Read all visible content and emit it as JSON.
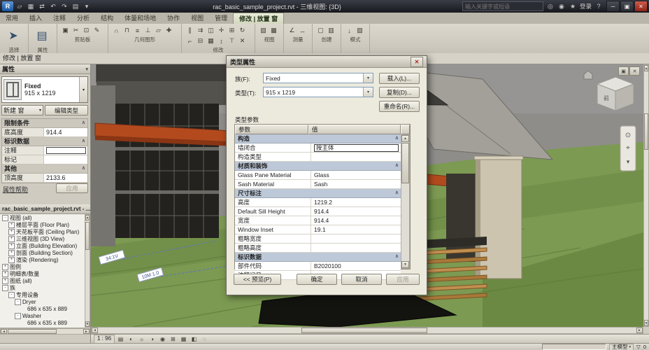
{
  "ui": {
    "dropdown_glyph": "▾",
    "pin_glyph": "∧",
    "up_glyph": "▲",
    "down_glyph": "▼",
    "left_glyph": "◄",
    "right_glyph": "►",
    "close_glyph": "✕",
    "restore_glyph": "▣"
  },
  "window": {
    "title": "rac_basic_sample_project.rvt - 三维视图: {3D}",
    "search_placeholder": "输入关键字或短语",
    "sign_in": "登录",
    "help_glyph": "?",
    "quick_access": [
      {
        "name": "app-menu-button",
        "glyph": "R",
        "big": true
      },
      {
        "name": "open-icon",
        "glyph": "▱"
      },
      {
        "name": "save-icon",
        "glyph": "▦"
      },
      {
        "name": "sync-icon",
        "glyph": "⇄"
      },
      {
        "name": "undo-icon",
        "glyph": "↶"
      },
      {
        "name": "redo-icon",
        "glyph": "↷"
      },
      {
        "name": "print-icon",
        "glyph": "▤"
      },
      {
        "name": "qat-customize-icon",
        "glyph": "▾"
      }
    ],
    "infocenter_icons": [
      {
        "name": "search-icon",
        "glyph": "◎"
      },
      {
        "name": "communication-center-icon",
        "glyph": "◉"
      },
      {
        "name": "favorites-icon",
        "glyph": "★"
      }
    ],
    "controls": [
      {
        "name": "minimize-button",
        "glyph": "─"
      },
      {
        "name": "restore-button",
        "glyph": "▣"
      },
      {
        "name": "close-button",
        "glyph": "✕",
        "close": true
      }
    ]
  },
  "ribbon": {
    "tabs": [
      "常用",
      "插入",
      "注释",
      "分析",
      "结构",
      "体量和场地",
      "协作",
      "视图",
      "管理",
      "修改 | 放置 窗"
    ],
    "active_tab": 9,
    "panels": [
      {
        "id": "select",
        "label": "选择",
        "icons": [
          {
            "name": "modify-tool-icon",
            "glyph": "➤",
            "big": true
          }
        ]
      },
      {
        "id": "properties",
        "label": "属性",
        "icons": [
          {
            "name": "properties-icon",
            "glyph": "▤",
            "big": true
          }
        ]
      },
      {
        "id": "clipboard",
        "label": "剪贴板",
        "icons": [
          {
            "name": "paste-icon",
            "glyph": "▣"
          },
          {
            "name": "cut-icon",
            "glyph": "✂"
          },
          {
            "name": "copy-icon",
            "glyph": "⊡"
          },
          {
            "name": "match-type-icon",
            "glyph": "✎"
          }
        ]
      },
      {
        "id": "geometry",
        "label": "几何图形",
        "icons": [
          {
            "name": "cope-icon",
            "glyph": "∩"
          },
          {
            "name": "cut-geometry-icon",
            "glyph": "⊓"
          },
          {
            "name": "join-geometry-icon",
            "glyph": "≡"
          },
          {
            "name": "wall-joins-icon",
            "glyph": "⊥"
          },
          {
            "name": "split-face-icon",
            "glyph": "▱"
          },
          {
            "name": "paint-icon",
            "glyph": "✚"
          }
        ]
      },
      {
        "id": "modify",
        "label": "修改",
        "icons": [
          {
            "name": "align-icon",
            "glyph": "∥"
          },
          {
            "name": "offset-icon",
            "glyph": "⇉"
          },
          {
            "name": "mirror-icon",
            "glyph": "◫"
          },
          {
            "name": "move-icon",
            "glyph": "✛"
          },
          {
            "name": "copy-element-icon",
            "glyph": "⊞"
          },
          {
            "name": "rotate-icon",
            "glyph": "↻"
          },
          {
            "name": "trim-icon",
            "glyph": "⌐"
          },
          {
            "name": "split-element-icon",
            "glyph": "⊟"
          },
          {
            "name": "array-icon",
            "glyph": "▦"
          },
          {
            "name": "scale-icon",
            "glyph": "↕"
          },
          {
            "name": "pin-icon",
            "glyph": "⊤"
          },
          {
            "name": "delete-icon",
            "glyph": "✕"
          }
        ]
      },
      {
        "id": "view",
        "label": "视图",
        "icons": [
          {
            "name": "thin-lines-icon",
            "glyph": "▨"
          },
          {
            "name": "close-hidden-icon",
            "glyph": "▩"
          }
        ]
      },
      {
        "id": "measure",
        "label": "测量",
        "icons": [
          {
            "name": "measure-icon",
            "glyph": "∠"
          },
          {
            "name": "dimension-icon",
            "glyph": "↔"
          }
        ]
      },
      {
        "id": "create",
        "label": "创建",
        "icons": [
          {
            "name": "create-similar-icon",
            "glyph": "▢"
          },
          {
            "name": "group-icon",
            "glyph": "▥"
          }
        ]
      },
      {
        "id": "mode",
        "label": "模式",
        "icons": [
          {
            "name": "load-family-icon",
            "glyph": "↓"
          },
          {
            "name": "model-in-place-icon",
            "glyph": "▧"
          }
        ]
      }
    ]
  },
  "properties": {
    "options_bar": "修改 | 放置 窗",
    "palette_title": "属性",
    "type_selector": {
      "family": "Fixed",
      "type": "915 x 1219"
    },
    "selection_combo": "新建 窗",
    "edit_type_button": "编辑类型",
    "rows": [
      {
        "kind": "group",
        "id": "constraints",
        "label": "限制条件"
      },
      {
        "kind": "row",
        "label": "底高度",
        "value": "914.4"
      },
      {
        "kind": "group",
        "id": "identity",
        "label": "标识数据"
      },
      {
        "kind": "row",
        "label": "注释",
        "value": "",
        "input": true
      },
      {
        "kind": "row",
        "label": "标记",
        "value": ""
      },
      {
        "kind": "group",
        "id": "other",
        "label": "其他"
      },
      {
        "kind": "row",
        "label": "顶高度",
        "value": "2133.6"
      }
    ],
    "help_link": "属性帮助",
    "apply_button": "应用"
  },
  "browser": {
    "title": "rac_basic_sample_project.rvt - ...",
    "items": [
      {
        "label": "视图 (all)",
        "indent": 0,
        "expander": "-"
      },
      {
        "label": "楼层平面 (Floor Plan)",
        "indent": 1,
        "expander": "+"
      },
      {
        "label": "天花板平面 (Ceiling Plan)",
        "indent": 1,
        "expander": "+"
      },
      {
        "label": "三维视图 (3D View)",
        "indent": 1,
        "expander": "+"
      },
      {
        "label": "立面 (Building Elevation)",
        "indent": 1,
        "expander": "+"
      },
      {
        "label": "剖面 (Building Section)",
        "indent": 1,
        "expander": "+"
      },
      {
        "label": "渲染 (Rendering)",
        "indent": 1,
        "expander": "+"
      },
      {
        "label": "图例",
        "indent": 0,
        "expander": "+"
      },
      {
        "label": "明细表/数量",
        "indent": 0,
        "expander": "+"
      },
      {
        "label": "图纸 (all)",
        "indent": 0,
        "expander": "+"
      },
      {
        "label": "族",
        "indent": 0,
        "expander": "-"
      },
      {
        "label": "专用设备",
        "indent": 1,
        "expander": "-"
      },
      {
        "label": "Dryer",
        "indent": 2,
        "expander": "-"
      },
      {
        "label": "686 x 635 x 889",
        "indent": 3,
        "expander": ""
      },
      {
        "label": "Washer",
        "indent": 2,
        "expander": "-"
      },
      {
        "label": "686 x 635 x 889",
        "indent": 3,
        "expander": ""
      }
    ]
  },
  "dialog": {
    "title": "类型属性",
    "family_label": "族(F):",
    "family_value": "Fixed",
    "load_button": "载入(L)...",
    "type_label": "类型(T):",
    "type_value": "915 x 1219",
    "duplicate_button": "复制(D)...",
    "rename_button": "重命名(R)...",
    "params_title": "类型参数",
    "col_param": "参数",
    "col_value": "值",
    "rows": [
      {
        "kind": "group",
        "label": "构造"
      },
      {
        "kind": "row",
        "label": "墙闭合",
        "value": "按主体",
        "editor": true
      },
      {
        "kind": "row",
        "label": "构造类型",
        "value": ""
      },
      {
        "kind": "group",
        "label": "材质和装饰"
      },
      {
        "kind": "row",
        "label": "Glass Pane Material",
        "value": "Glass"
      },
      {
        "kind": "row",
        "label": "Sash Material",
        "value": "Sash"
      },
      {
        "kind": "group",
        "label": "尺寸标注"
      },
      {
        "kind": "row",
        "label": "高度",
        "value": "1219.2"
      },
      {
        "kind": "row",
        "label": "Default Sill Height",
        "value": "914.4"
      },
      {
        "kind": "row",
        "label": "宽度",
        "value": "914.4"
      },
      {
        "kind": "row",
        "label": "Window Inset",
        "value": "19.1"
      },
      {
        "kind": "row",
        "label": "粗略宽度",
        "value": ""
      },
      {
        "kind": "row",
        "label": "粗略高度",
        "value": ""
      },
      {
        "kind": "group",
        "label": "标识数据"
      },
      {
        "kind": "row",
        "label": "部件代码",
        "value": "B2020100"
      },
      {
        "kind": "row",
        "label": "注释记号",
        "value": ""
      }
    ],
    "preview_button": "<< 预览(P)",
    "ok_button": "确定",
    "cancel_button": "取消",
    "apply_button": "应用"
  },
  "canvas": {
    "viewcube_front": "前",
    "labels": [
      "34:1V",
      "10M 1.0"
    ],
    "nav_icons": [
      "⊙",
      "⌖",
      "▾"
    ]
  },
  "status": {
    "view_scale": "1 : 96",
    "view_icons": [
      {
        "name": "detail-level-icon",
        "glyph": "▤"
      },
      {
        "name": "visual-style-icon",
        "glyph": "◐"
      },
      {
        "name": "sun-path-icon",
        "glyph": "☼"
      },
      {
        "name": "shadows-icon",
        "glyph": "◑"
      },
      {
        "name": "rendering-icon",
        "glyph": "◉"
      },
      {
        "name": "crop-view-icon",
        "glyph": "⊞"
      },
      {
        "name": "show-crop-icon",
        "glyph": "▦"
      },
      {
        "name": "temporary-hide-icon",
        "glyph": "◧"
      },
      {
        "name": "reveal-hidden-icon",
        "glyph": "◌"
      }
    ],
    "main_model_label": "主模型",
    "filter_glyph": "▽",
    "filter_count": "0"
  }
}
